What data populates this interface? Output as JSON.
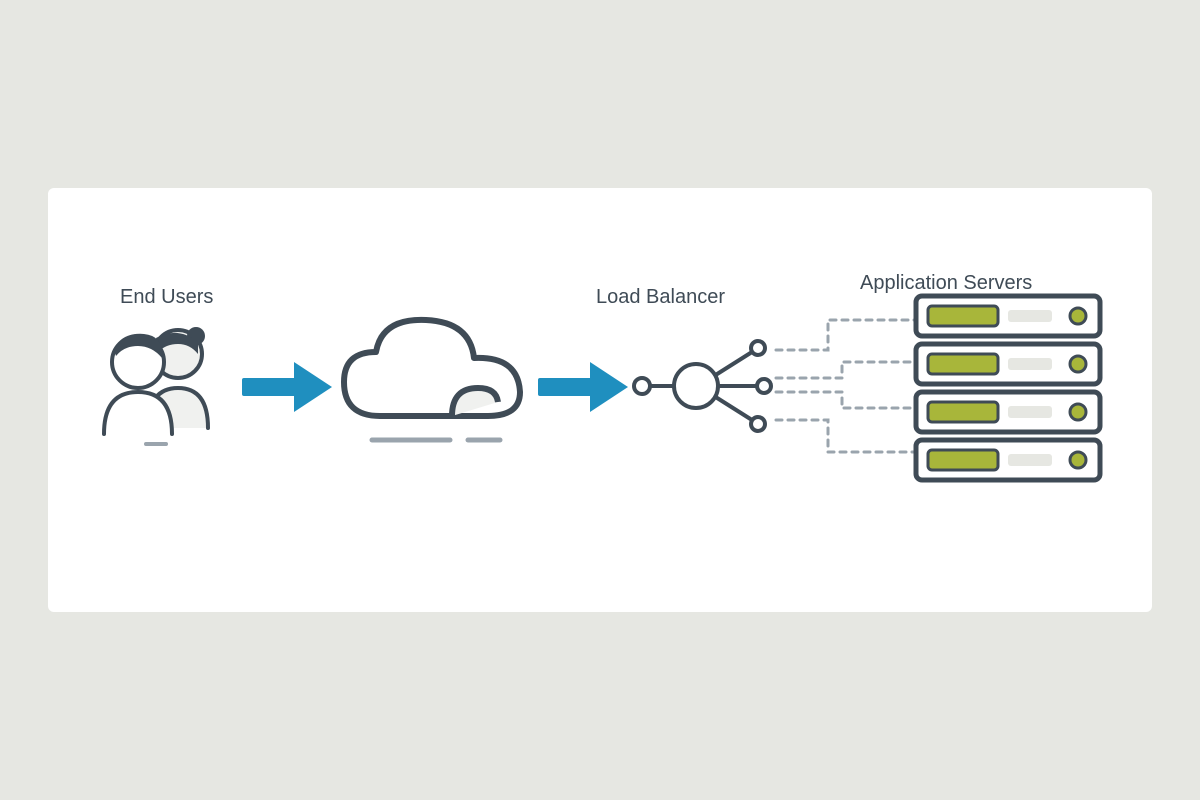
{
  "diagram": {
    "nodes": {
      "end_users": {
        "label": "End Users"
      },
      "cloud": {
        "label": ""
      },
      "load_balancer": {
        "label": "Load Balancer"
      },
      "app_servers": {
        "label": "Application Servers",
        "count": 4
      }
    },
    "flow": [
      "end_users",
      "cloud",
      "load_balancer",
      "app_servers"
    ],
    "colors": {
      "stroke": "#3f4b56",
      "arrow": "#1f8fbf",
      "accent": "#a8b63a",
      "dashed": "#9aa4ad",
      "fill": "#ffffff",
      "shade": "#f0f1ef"
    }
  }
}
